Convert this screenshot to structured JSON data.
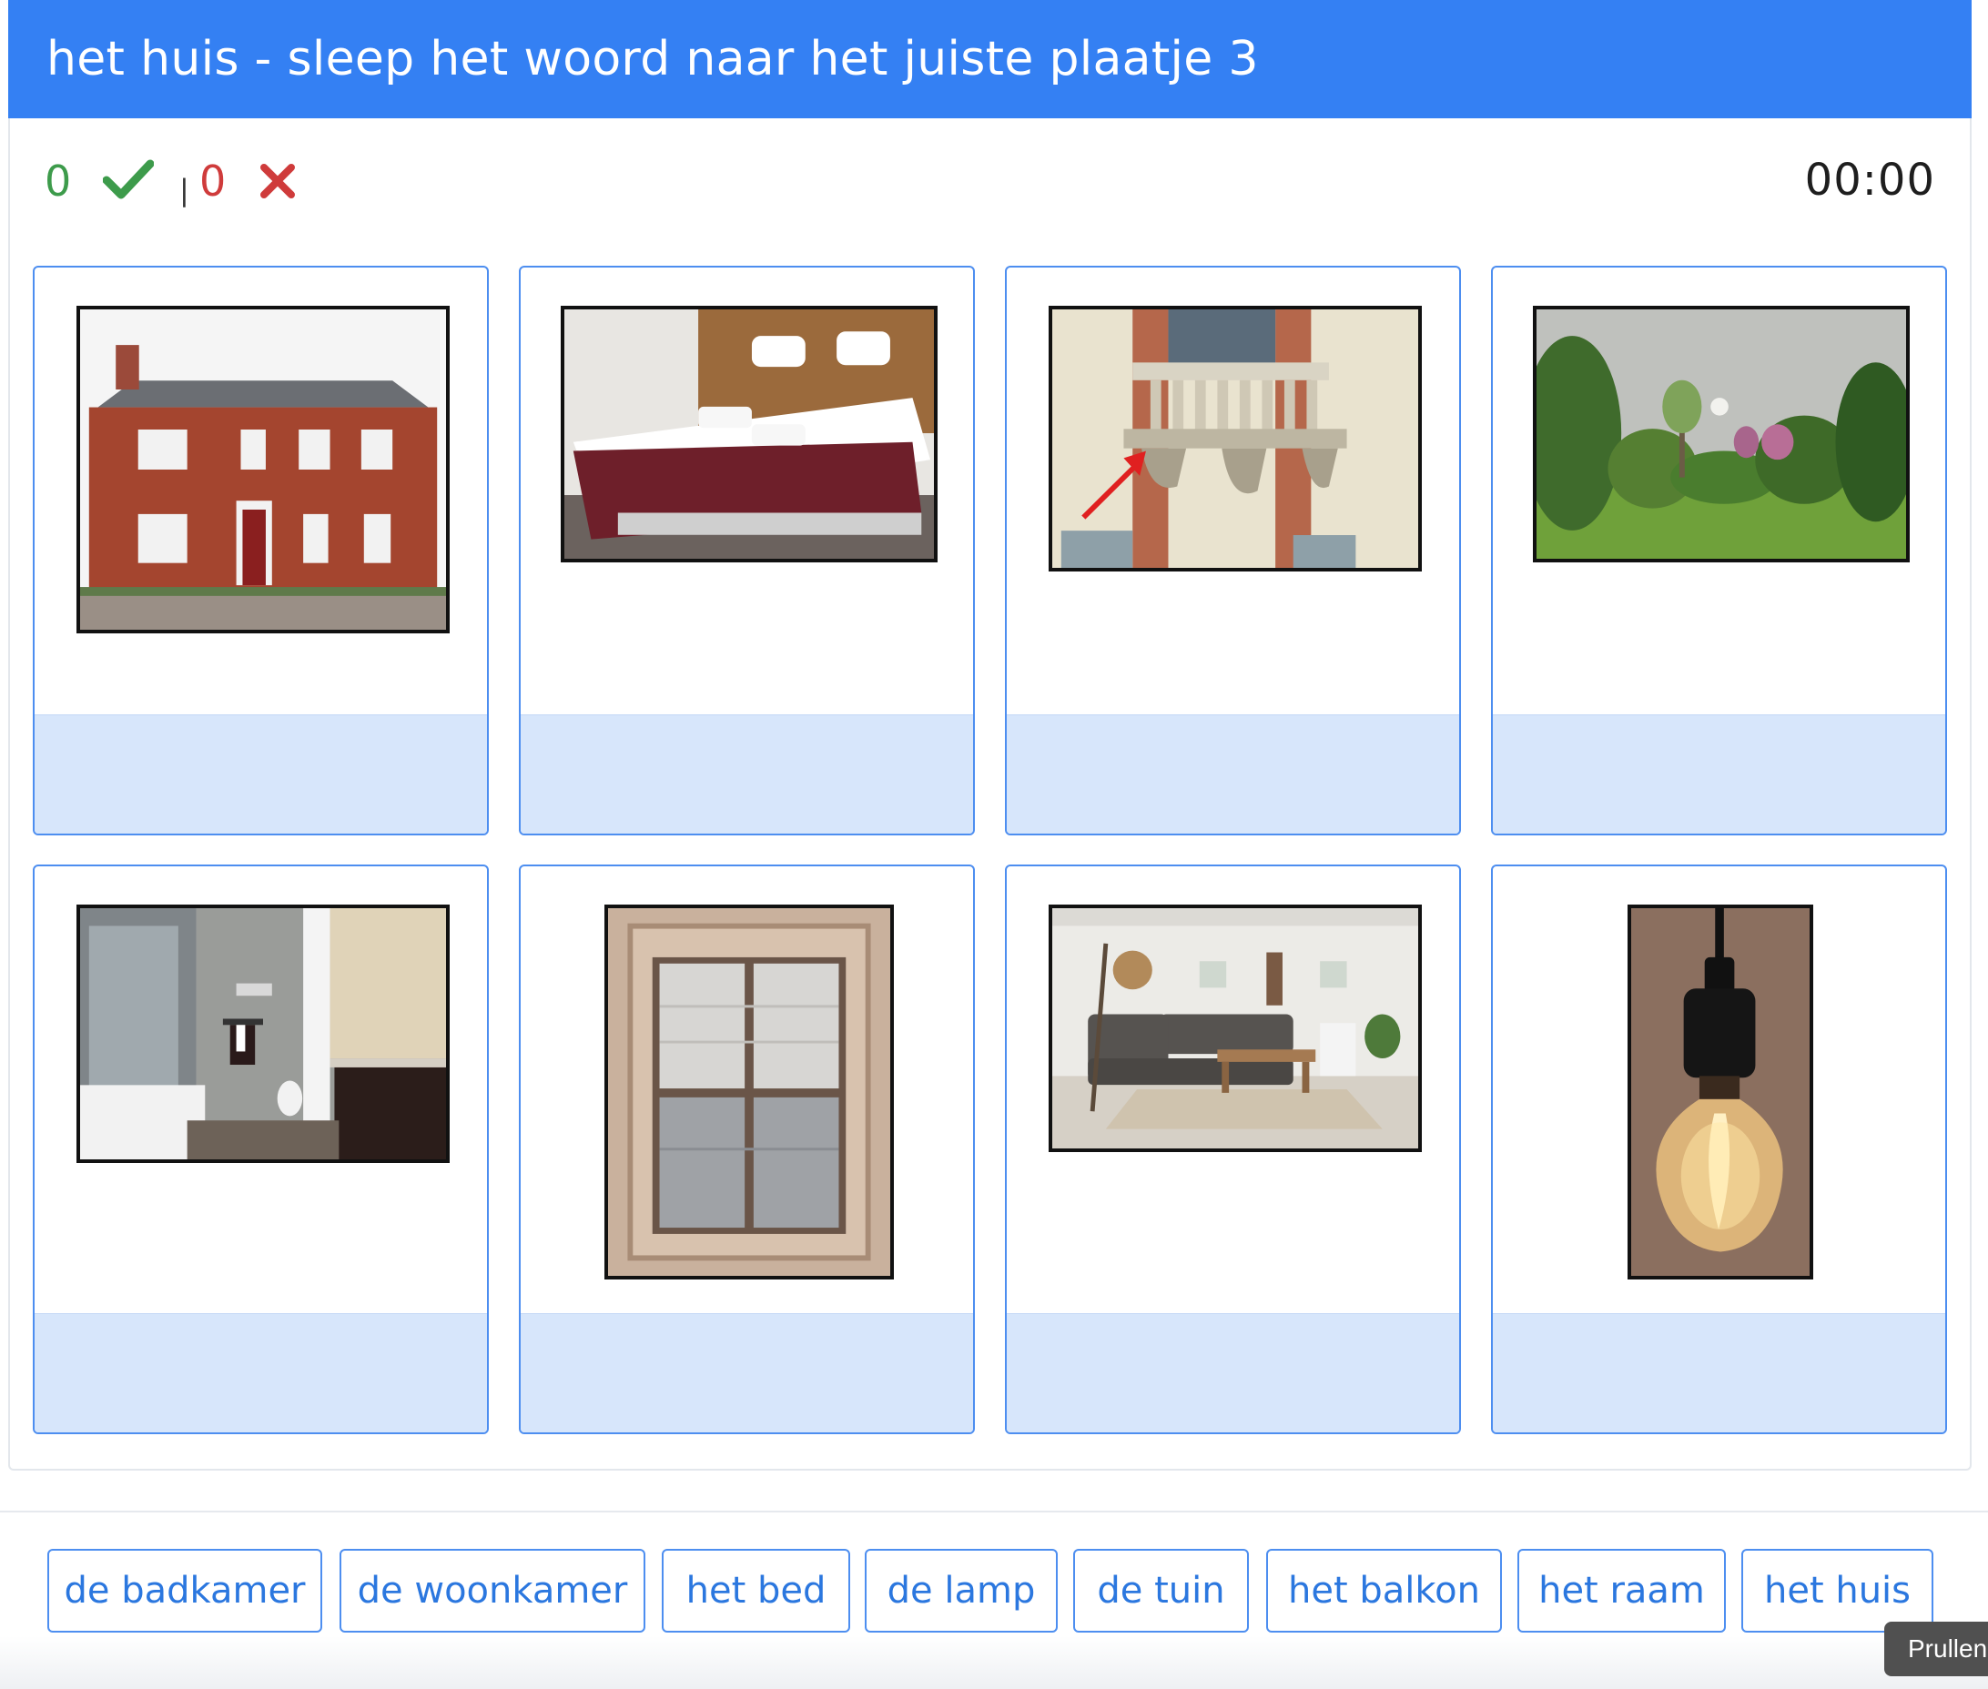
{
  "header": {
    "title": "het huis - sleep het woord naar het juiste plaatje 3"
  },
  "score": {
    "correct": "0",
    "separator": "|",
    "wrong": "0",
    "timer": "00:00"
  },
  "cards": [
    {
      "image": "house-photo"
    },
    {
      "image": "bed-photo"
    },
    {
      "image": "balcony-photo"
    },
    {
      "image": "garden-photo"
    },
    {
      "image": "bathroom-photo"
    },
    {
      "image": "window-photo"
    },
    {
      "image": "living-room-photo"
    },
    {
      "image": "lamp-photo"
    }
  ],
  "words": [
    "de badkamer",
    "de woonkamer",
    "het bed",
    "de lamp",
    "de tuin",
    "het balkon",
    "het raam",
    "het huis"
  ],
  "tooltip": {
    "text": "Prullenbak"
  },
  "colors": {
    "header": "#3480f3",
    "correct": "#3d9b4b",
    "wrong": "#cf3b3b",
    "dropzone": "#d7e6fb",
    "accent": "#4d8ef0"
  }
}
